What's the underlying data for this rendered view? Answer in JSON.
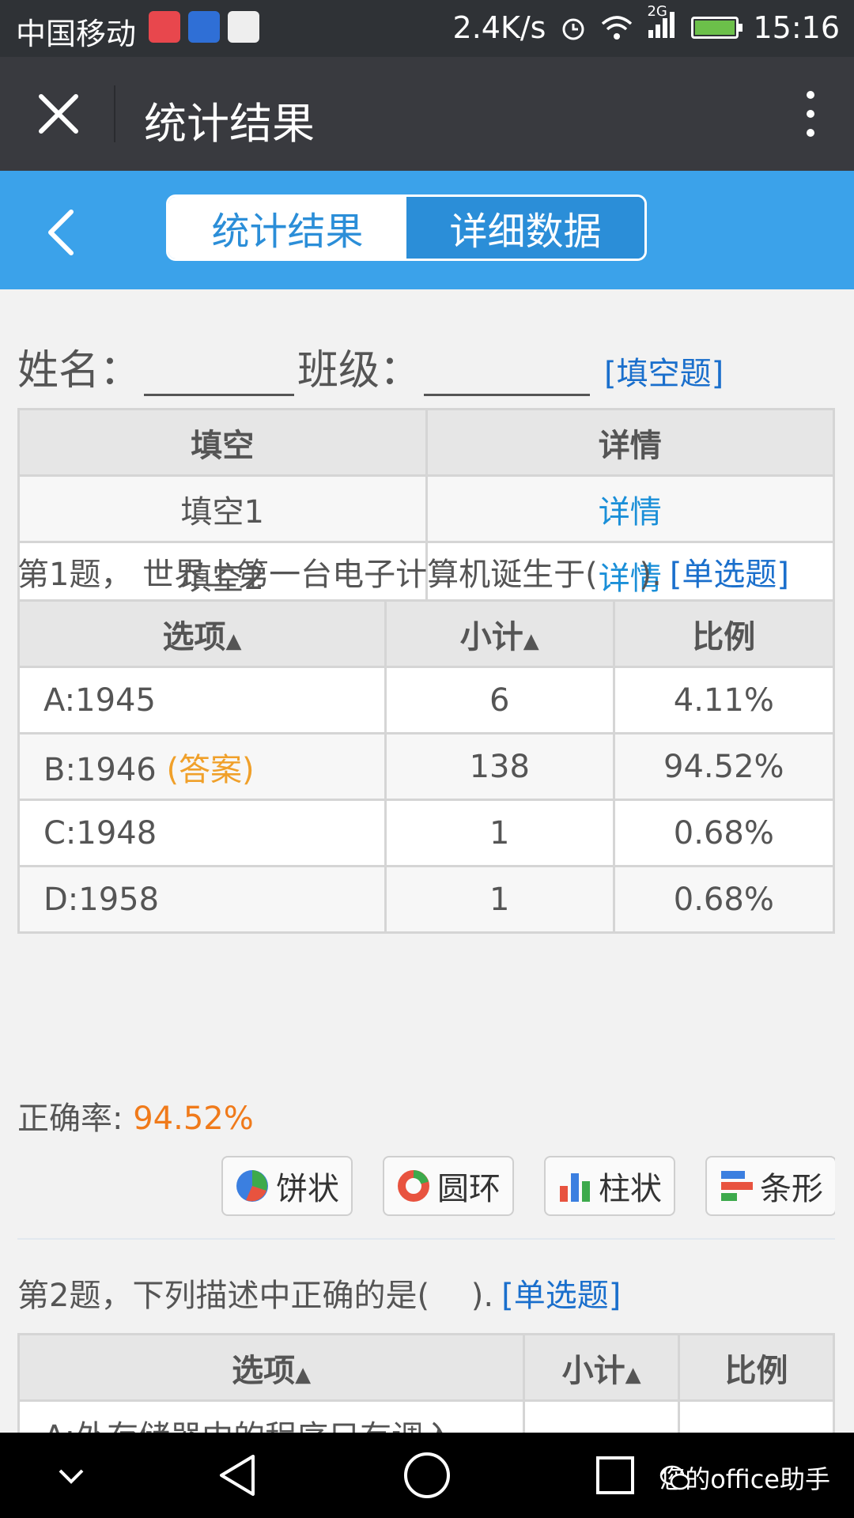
{
  "status_bar": {
    "carrier": "中国移动",
    "speed": "2.4K/s",
    "network": "2G",
    "time": "15:16"
  },
  "title_bar": {
    "title": "统计结果"
  },
  "tabs": [
    {
      "label": "统计结果",
      "active": true
    },
    {
      "label": "详细数据",
      "active": false
    }
  ],
  "name_line": {
    "name_label": "姓名：",
    "class_label": "班级：",
    "type_link": "[填空题]"
  },
  "blank_table": {
    "headers": [
      "填空",
      "详情"
    ],
    "rows": [
      {
        "name": "填空1",
        "action": "详情"
      },
      {
        "name": "填空2",
        "action": "详情"
      }
    ]
  },
  "question1": {
    "text": "第1题， 世界上第一台电子计算机诞生于(　 ).",
    "type": "[单选题]",
    "headers": [
      "选项",
      "小计",
      "比例"
    ],
    "rows": [
      {
        "option": "A:1945",
        "answer_tag": "",
        "count": "6",
        "ratio": "4.11%"
      },
      {
        "option": "B:1946",
        "answer_tag": "(答案)",
        "count": "138",
        "ratio": "94.52%"
      },
      {
        "option": "C:1948",
        "answer_tag": "",
        "count": "1",
        "ratio": "0.68%"
      },
      {
        "option": "D:1958",
        "answer_tag": "",
        "count": "1",
        "ratio": "0.68%"
      }
    ],
    "accuracy_label": "正确率:",
    "accuracy_value": "94.52%"
  },
  "chart_buttons": [
    {
      "label": "饼状",
      "icon": "pie-chart-icon"
    },
    {
      "label": "圆环",
      "icon": "donut-chart-icon"
    },
    {
      "label": "柱状",
      "icon": "bar-chart-icon"
    },
    {
      "label": "条形",
      "icon": "horizontal-bar-chart-icon"
    }
  ],
  "question2": {
    "text": "第2题，下列描述中正确的是(　 ).",
    "type": "[单选题]",
    "headers": [
      "选项",
      "小计",
      "比例"
    ],
    "partial_row": "A:外存储器中的程序只有调入"
  },
  "nav_bar": {
    "watermark": "您的office助手"
  },
  "colors": {
    "header_blue": "#3ba2ea",
    "link_blue": "#1a8fd8",
    "answer_orange": "#f0a02a",
    "accuracy_orange": "#f07a1a"
  }
}
